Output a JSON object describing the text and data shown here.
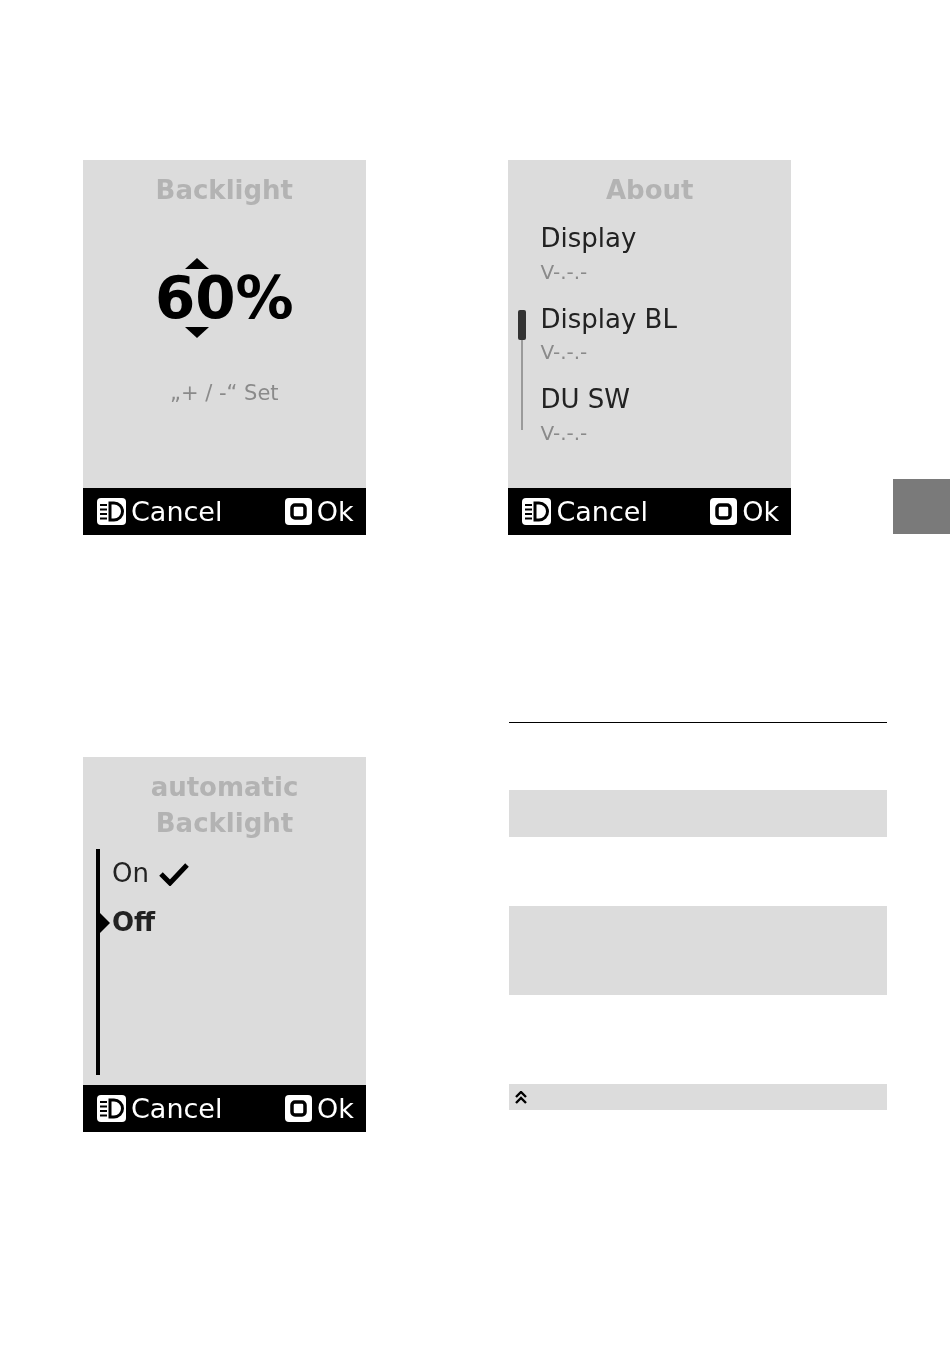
{
  "screens": [
    {
      "kind": "value",
      "title": "Backlight",
      "value": "60%",
      "hint": "„+ / -“ Set",
      "footer": {
        "cancel": "Cancel",
        "ok": "Ok"
      }
    },
    {
      "kind": "list",
      "title": "About",
      "items": [
        {
          "name": "Display",
          "version": "V-.-.-"
        },
        {
          "name": "Display BL",
          "version": "V-.-.-"
        },
        {
          "name": "DU SW",
          "version": "V-.-.-"
        }
      ],
      "footer": {
        "cancel": "Cancel",
        "ok": "Ok"
      }
    },
    {
      "kind": "options",
      "title": "automatic Backlight",
      "options": [
        {
          "label": "On",
          "checked": true,
          "selected": false
        },
        {
          "label": "Off",
          "checked": false,
          "selected": true
        }
      ],
      "footer": {
        "cancel": "Cancel",
        "ok": "Ok"
      }
    }
  ]
}
